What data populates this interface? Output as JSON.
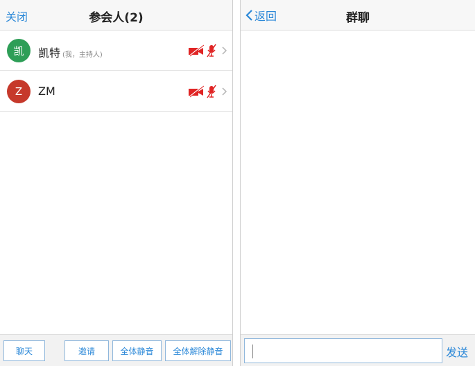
{
  "participants_screen": {
    "close_label": "关闭",
    "title": "参会人(2)",
    "participants": [
      {
        "avatar_text": "凯",
        "avatar_color": "#2e9e57",
        "name": "凯特",
        "role": "(我，主持人)"
      },
      {
        "avatar_text": "Z",
        "avatar_color": "#c6392b",
        "name": "ZM",
        "role": ""
      }
    ],
    "toolbar": {
      "chat_label": "聊天",
      "invite_label": "邀请",
      "mute_all_label": "全体静音",
      "unmute_all_label": "全体解除静音"
    },
    "status_icon_color": "#e02424"
  },
  "chat_screen": {
    "back_label": "返回",
    "title": "群聊",
    "input_value": "",
    "send_label": "发送"
  }
}
